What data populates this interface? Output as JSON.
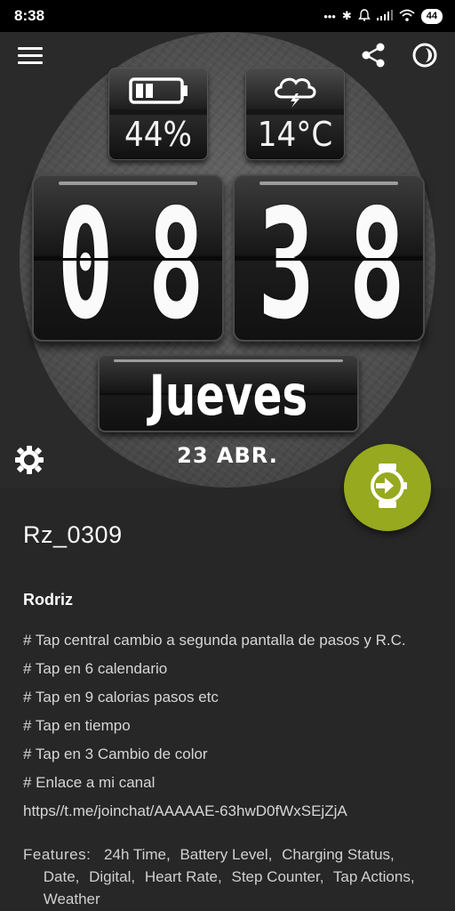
{
  "status_bar": {
    "time": "8:38",
    "icons": [
      "more-dots-icon",
      "bluetooth-icon",
      "alarm-icon",
      "signal-icon",
      "wifi-icon"
    ],
    "battery": "44"
  },
  "toolbar": {
    "menu_icon": "hamburger-menu-icon",
    "share_icon": "share-icon",
    "theme_icon": "contrast-icon"
  },
  "watch_face": {
    "battery_value": "44%",
    "weather_value": "14°C",
    "hour_d1": "0",
    "hour_d2": "8",
    "min_d1": "3",
    "min_d2": "8",
    "day": "Jueves",
    "date": "23 ABR."
  },
  "settings_icon": "gear-icon",
  "fab_icon": "watch-send-icon",
  "colors": {
    "accent": "#97a91f",
    "background": "#272727"
  },
  "details": {
    "title": "Rz_0309",
    "author": "Rodriz",
    "description": [
      "# Tap central cambio a segunda pantalla de pasos y R.C.",
      "# Tap en 6 calendario",
      "# Tap en 9 calorias pasos etc",
      "# Tap en tiempo",
      "# Tap en 3 Cambio de color",
      "# Enlace a mi canal",
      "https//t.me/joinchat/AAAAAE-63hwD0fWxSEjZjA"
    ],
    "features_label": "Features:",
    "features": [
      "24h Time,",
      "Battery Level,",
      "Charging Status,",
      "Date,",
      "Digital,",
      "Heart Rate,",
      "Step Counter,",
      "Tap Actions,",
      "Weather"
    ]
  }
}
